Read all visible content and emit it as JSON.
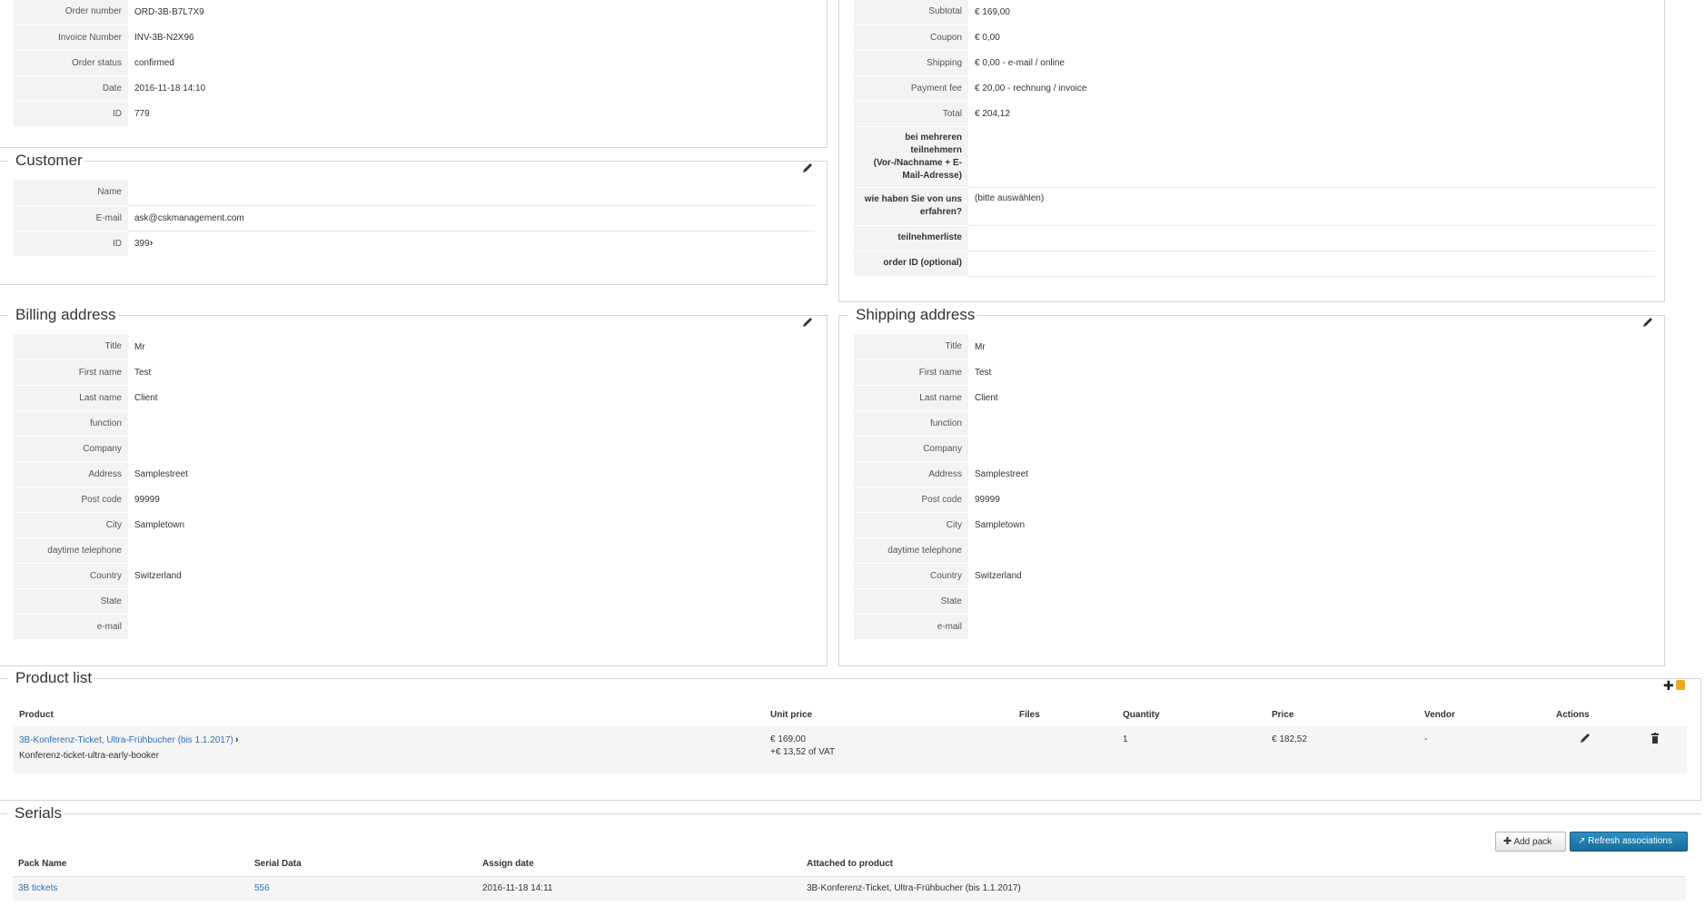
{
  "order": {
    "rows": [
      {
        "label": "Order number",
        "value": "ORD-3B-B7L7X9"
      },
      {
        "label": "Invoice Number",
        "value": "INV-3B-N2X96"
      },
      {
        "label": "Order status",
        "value": "confirmed"
      },
      {
        "label": "Date",
        "value": "2016-11-18 14:10"
      },
      {
        "label": "ID",
        "value": "779"
      }
    ]
  },
  "totals": {
    "rows": [
      {
        "label": "Subtotal",
        "value": "€ 169,00"
      },
      {
        "label": "Coupon",
        "value": "€ 0,00"
      },
      {
        "label": "Shipping",
        "value": "€ 0,00 - e-mail / online"
      },
      {
        "label": "Payment fee",
        "value": "€ 20,00 - rechnung / invoice"
      },
      {
        "label": "Total",
        "value": "€ 204,12"
      }
    ],
    "extra": [
      {
        "label": "bei mehreren teilnehmern (Vor-/Nachname + E-Mail-Adresse)",
        "value": ""
      },
      {
        "label": "wie haben Sie von uns erfahren?",
        "value": "(bitte auswählen)"
      },
      {
        "label": "teilnehmerliste",
        "value": ""
      },
      {
        "label": "order ID (optional)",
        "value": ""
      }
    ]
  },
  "customer": {
    "title": "Customer",
    "name_label": "Name",
    "name_value": "",
    "email_label": "E-mail",
    "email_value": "ask@cskmanagement.com",
    "id_label": "ID",
    "id_value": "399"
  },
  "billing": {
    "title": "Billing address",
    "rows": [
      {
        "label": "Title",
        "value": "Mr"
      },
      {
        "label": "First name",
        "value": "Test"
      },
      {
        "label": "Last name",
        "value": "Client"
      },
      {
        "label": "function",
        "value": ""
      },
      {
        "label": "Company",
        "value": ""
      },
      {
        "label": "Address",
        "value": "Samplestreet"
      },
      {
        "label": "Post code",
        "value": "99999"
      },
      {
        "label": "City",
        "value": "Sampletown"
      },
      {
        "label": "daytime telephone",
        "value": ""
      },
      {
        "label": "Country",
        "value": "Switzerland"
      },
      {
        "label": "State",
        "value": ""
      },
      {
        "label": "e-mail",
        "value": ""
      }
    ]
  },
  "shipping": {
    "title": "Shipping address",
    "rows": [
      {
        "label": "Title",
        "value": "Mr"
      },
      {
        "label": "First name",
        "value": "Test"
      },
      {
        "label": "Last name",
        "value": "Client"
      },
      {
        "label": "function",
        "value": ""
      },
      {
        "label": "Company",
        "value": ""
      },
      {
        "label": "Address",
        "value": "Samplestreet"
      },
      {
        "label": "Post code",
        "value": "99999"
      },
      {
        "label": "City",
        "value": "Sampletown"
      },
      {
        "label": "daytime telephone",
        "value": ""
      },
      {
        "label": "Country",
        "value": "Switzerland"
      },
      {
        "label": "State",
        "value": ""
      },
      {
        "label": "e-mail",
        "value": ""
      }
    ]
  },
  "products": {
    "title": "Product list",
    "headers": {
      "product": "Product",
      "unit_price": "Unit price",
      "files": "Files",
      "quantity": "Quantity",
      "price": "Price",
      "vendor": "Vendor",
      "actions": "Actions"
    },
    "row": {
      "name": "3B-Konferenz-Ticket, Ultra-Frühbucher (bis 1.1.2017)",
      "sku": "Konferenz-ticket-ultra-early-booker",
      "unit_price": "€ 169,00",
      "vat": "+€ 13,52 of VAT",
      "files": "",
      "quantity": "1",
      "price": "€ 182,52",
      "vendor": "-"
    }
  },
  "serials": {
    "title": "Serials",
    "add_pack": "Add pack",
    "refresh": "Refresh associations",
    "headers": {
      "pack_name": "Pack Name",
      "serial_data": "Serial Data",
      "assign_date": "Assign date",
      "attached": "Attached to product"
    },
    "row": {
      "pack_name": "3B tickets",
      "serial_data": "556",
      "assign_date": "2016-11-18 14:11",
      "attached": "3B-Konferenz-Ticket, Ultra-Frühbucher (bis 1.1.2017)"
    }
  },
  "colors": {
    "link": "#2f6fb0",
    "primary_button": "#1f7aab",
    "label_bg": "#f3f3f3"
  }
}
